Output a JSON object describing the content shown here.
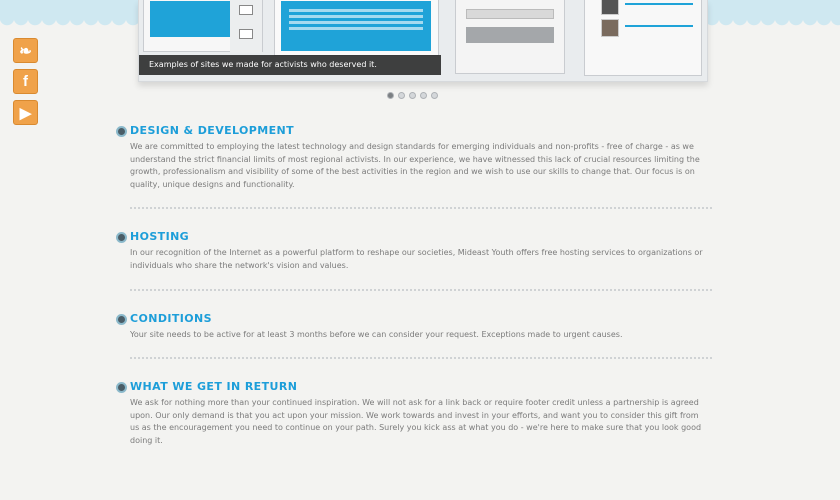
{
  "social": [
    {
      "name": "twitter",
      "glyph": "❧"
    },
    {
      "name": "facebook",
      "glyph": "f"
    },
    {
      "name": "youtube",
      "glyph": "▶"
    }
  ],
  "slider": {
    "caption": "Examples of sites we made for activists who deserved it.",
    "dots": 5,
    "active_dot": 1
  },
  "sections": [
    {
      "heading": "DESIGN & DEVELOPMENT",
      "text": "We are committed to employing the latest technology and design standards for emerging individuals and non-profits - free of charge - as we understand the strict financial limits of most regional activists. In our experience, we have witnessed this lack of crucial resources limiting the growth, professionalism and visibility of some of the best activities in the region and we wish to use our skills to change that. Our focus is on quality, unique designs and functionality."
    },
    {
      "heading": "HOSTING",
      "text": "In our recognition of the Internet as a powerful platform to reshape our societies, Mideast Youth offers free hosting services to organizations or individuals who share the network's vision and values."
    },
    {
      "heading": "CONDITIONS",
      "text": "Your site needs to be active for at least 3 months before we can consider your request. Exceptions made to urgent causes."
    },
    {
      "heading": "WHAT WE GET IN RETURN",
      "text": "We ask for nothing more than your continued inspiration. We will not ask for a link back or require footer credit unless a partnership is agreed upon. Our only demand is that you act upon your mission. We work towards and invest in your efforts, and want you to consider this gift from us as the encouragement you need to continue on your path. Surely you kick ass at what you do - we're here to make sure that you look good doing it."
    }
  ],
  "colors": {
    "accent": "#1d9ed9",
    "social": "#f0a24a",
    "body_text": "#7b7b7b"
  }
}
